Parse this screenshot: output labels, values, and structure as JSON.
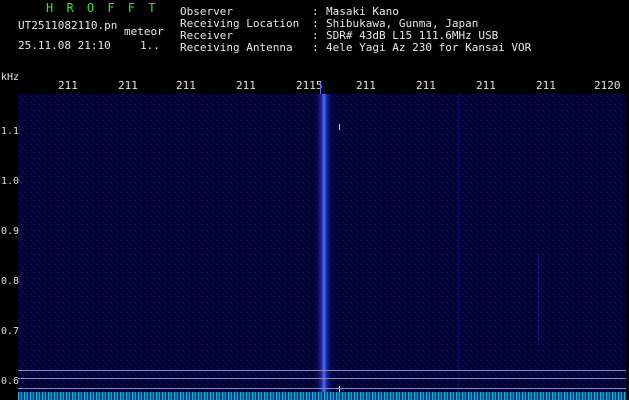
{
  "app": {
    "title": "H R O F F T"
  },
  "file": {
    "name": "UT2511082110.pn",
    "mode": "meteor",
    "datetime": "25.11.08 21:10",
    "extra": "1.."
  },
  "info": {
    "rows": [
      {
        "label": "Observer",
        "value": "Masaki Kano"
      },
      {
        "label": "Receiving Location",
        "value": "Shibukawa, Gunma, Japan"
      },
      {
        "label": "Receiver",
        "value": "SDR# 43dB L15 111.6MHz USB"
      },
      {
        "label": "Receiving Antenna",
        "value": "4ele Yagi Az 230 for Kansai VOR"
      }
    ]
  },
  "axis": {
    "unit": "kHz",
    "x_ticks": [
      "211",
      "211",
      "211",
      "211",
      "2115",
      "211",
      "211",
      "211",
      "211",
      "2120"
    ],
    "y_ticks": [
      "1.1",
      "1.0",
      "0.9",
      "0.8",
      "0.7",
      "0.6"
    ]
  },
  "colors": {
    "background": "#000000",
    "plot": "#020235",
    "title": "#22ee22",
    "signal": "#4a6aff"
  }
}
